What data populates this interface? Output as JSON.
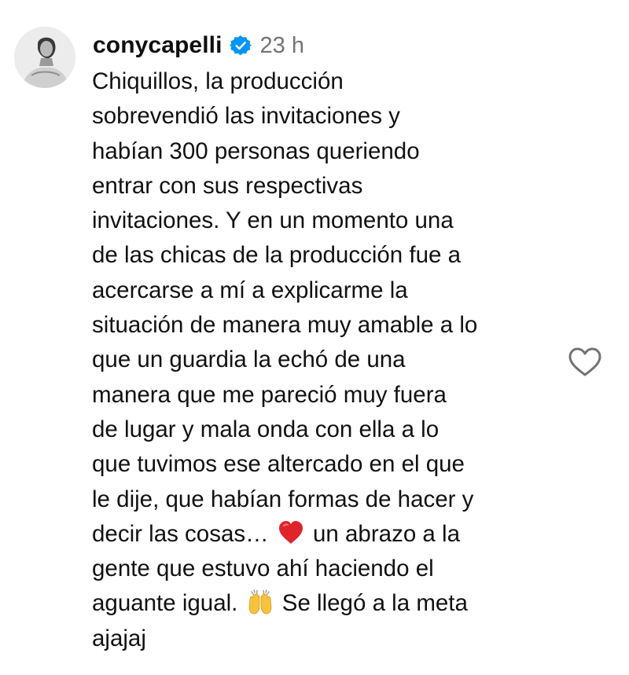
{
  "comment": {
    "username": "conycapelli",
    "verified": true,
    "timestamp": "23 h",
    "lines": [
      "Chiquillos, la producción",
      "sobrevendió las invitaciones y",
      "habían 300 personas queriendo",
      "entrar con sus respectivas",
      "invitaciones. Y en un momento una",
      "de las chicas de la producción fue a",
      "acercarse a mí a explicarme la",
      "situación de manera muy amable a lo",
      "que un guardia la echó de una",
      "manera que me pareció muy fuera",
      "de lugar y mala onda con ella a lo",
      "que tuvimos ese altercado en el que",
      "le dije, que habían formas de hacer y"
    ],
    "line_emoji_1_before": "decir las cosas…",
    "line_emoji_1_after": "un abrazo a la",
    "line_14": "gente que estuvo ahí haciendo el",
    "line_emoji_2_before": "aguante igual.",
    "line_emoji_2_after": "Se llegó a la meta",
    "line_16": "ajajaj",
    "emoji_1": "red-heart",
    "emoji_2": "raising-hands"
  },
  "colors": {
    "username": "#0f0f0f",
    "text": "#111111",
    "timestamp": "#737373",
    "verified_badge": "#0095f6",
    "like_icon": "#737373",
    "heart_emoji": "#e0242c",
    "hands_emoji": "#f6c33d"
  },
  "icons": {
    "verified": "verified-badge-icon",
    "like": "heart-outline-icon"
  }
}
